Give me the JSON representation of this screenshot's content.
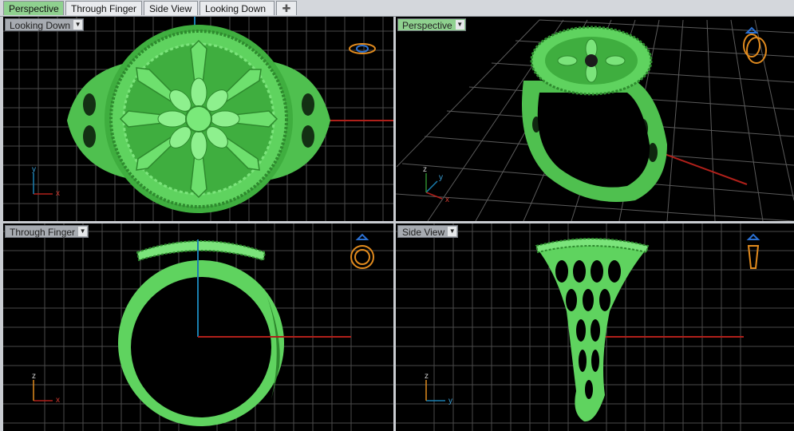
{
  "tabs": [
    {
      "label": "Perspective",
      "active": true
    },
    {
      "label": "Through Finger",
      "active": false
    },
    {
      "label": "Side View",
      "active": false
    },
    {
      "label": "Looking Down",
      "active": false
    }
  ],
  "tab_add_symbol": "✚",
  "viewports": {
    "top_left": {
      "label": "Looking Down",
      "active": false,
      "axis_x": "x",
      "axis_y": "y"
    },
    "top_right": {
      "label": "Perspective",
      "active": true,
      "axis_x": "x",
      "axis_y": "y",
      "axis_z": "z"
    },
    "bottom_left": {
      "label": "Through Finger",
      "active": false,
      "axis_x": "x",
      "axis_y": "z"
    },
    "bottom_right": {
      "label": "Side View",
      "active": false,
      "axis_x": "y",
      "axis_y": "z"
    }
  },
  "dropdown_symbol": "▼",
  "colors": {
    "model_green": "#5fd35f",
    "grid_line": "#5a5a5a",
    "x_axis": "#b0201a",
    "y_axis": "#1a7fb0",
    "view_widget": "#e08a1e",
    "active_tab": "#8fd18f"
  }
}
